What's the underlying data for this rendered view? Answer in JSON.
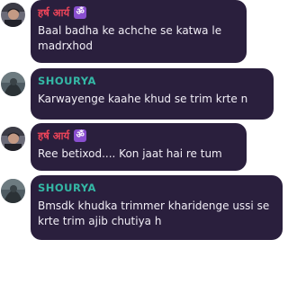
{
  "messages": [
    {
      "sender": "हर्ष आर्य",
      "badge": "ॐ",
      "text": "Baal badha ke achche se katwa le madrxhod"
    },
    {
      "sender": "SHOURYA",
      "badge": "",
      "text": "Karwayenge kaahe khud se trim krte n"
    },
    {
      "sender": "हर्ष आर्य",
      "badge": "ॐ",
      "text": "Ree betixod.... Kon jaat hai re tum"
    },
    {
      "sender": "SHOURYA",
      "badge": "",
      "text": "Bmsdk khudka trimmer kharidenge ussi se krte trim ajib chutiya h"
    }
  ],
  "colors": {
    "bubble_bg": "#2a1f3d",
    "sender_a": "#f0455a",
    "sender_b": "#34b8a6",
    "badge_bg": "#8a4fd0",
    "text": "#f1eef6"
  }
}
